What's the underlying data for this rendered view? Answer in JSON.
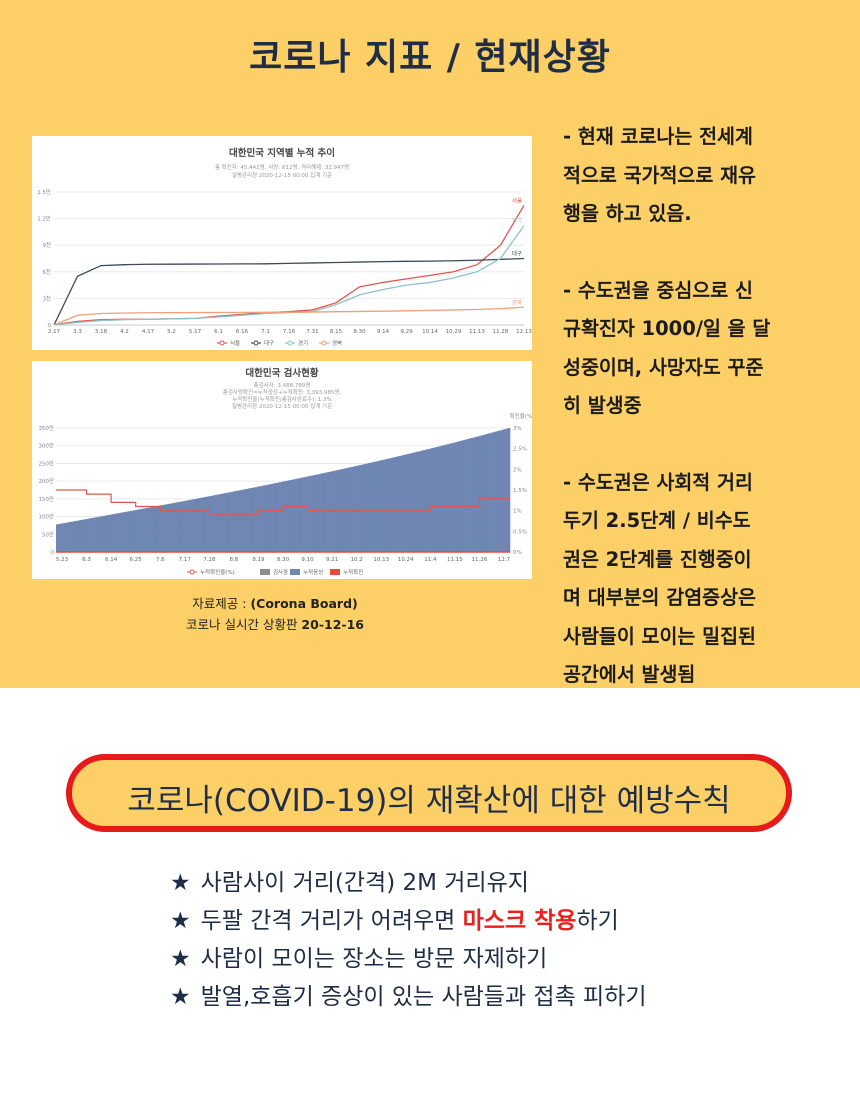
{
  "title": "코로나 지표 / 현재상황",
  "bullets": [
    "- 현재 코로나는 전세계\n적으로 국가적으로 재유\n행을 하고 있음.",
    "- 수도권을 중심으로 신\n규확진자 1000/일 을 달\n성중이며, 사망자도 꾸준\n히 발생중",
    "- 수도권은 사회적 거리\n두기 2.5단계 / 비수도\n권은 2단계를 진행중이\n며 대부분의 감염증상은\n사람들이 모이는 밀집된\n공간에서 발생됨"
  ],
  "source": {
    "line1_prefix": "자료제공 : ",
    "line1_bold": "(Corona Board)",
    "line2_prefix": "코로나 실시간 상황판 ",
    "line2_bold": "20-12-16"
  },
  "banner": "코로나(COVID-19)의 재확산에 대한 예방수칙",
  "rules": [
    {
      "star": "★",
      "before": "사람사이 거리(간격) 2M 거리유지",
      "highlight": "",
      "after": ""
    },
    {
      "star": "★",
      "before": "두팔 간격 거리가 어려우면 ",
      "highlight": "마스크 착용",
      "after": "하기"
    },
    {
      "star": "★",
      "before": "사람이 모이는 장소는 방문 자제하기",
      "highlight": "",
      "after": ""
    },
    {
      "star": "★",
      "before": "발열,호흡기 증상이 있는 사람들과 접촉 피하기",
      "highlight": "",
      "after": ""
    }
  ],
  "colors": {
    "background_top": "#fdd067",
    "title_text": "#1f2d47",
    "banner_border": "#e61a1a",
    "highlight": "#ee1c1c"
  },
  "chart_data": [
    {
      "type": "line",
      "title": "대한민국 지역별 누적 추이",
      "subtitle": [
        "총 확진자: 45,442명, 사망: 612명, 격리해제: 32,947명",
        "질병관리청 2020-12-15 00:00 집계 기준"
      ],
      "x": [
        "2.17",
        "3.3",
        "3.18",
        "4.2",
        "4.17",
        "5.2",
        "5.17",
        "6.1",
        "6.16",
        "7.1",
        "7.16",
        "7.31",
        "8.15",
        "8.30",
        "9.14",
        "9.29",
        "10.14",
        "10.29",
        "11.13",
        "11.28",
        "12.13"
      ],
      "yticks": [
        "0",
        "3천",
        "6천",
        "9천",
        "1.2만",
        "1.5만"
      ],
      "ylim": [
        0,
        15000
      ],
      "series": [
        {
          "name": "서울",
          "color": "#e0564f",
          "values": [
            20,
            400,
            600,
            650,
            650,
            700,
            750,
            1000,
            1200,
            1400,
            1500,
            1700,
            2500,
            4300,
            4800,
            5200,
            5600,
            6000,
            6800,
            9000,
            13500
          ]
        },
        {
          "name": "대구",
          "color": "#3c4a5c",
          "values": [
            0,
            5500,
            6700,
            6800,
            6850,
            6860,
            6870,
            6880,
            6890,
            6900,
            6950,
            7000,
            7050,
            7100,
            7150,
            7180,
            7200,
            7250,
            7300,
            7400,
            7500
          ]
        },
        {
          "name": "경기",
          "color": "#8fc3c9",
          "values": [
            5,
            300,
            500,
            600,
            650,
            700,
            750,
            900,
            1100,
            1300,
            1400,
            1500,
            2300,
            3400,
            4000,
            4500,
            4800,
            5300,
            6000,
            7500,
            11200
          ]
        },
        {
          "name": "경북",
          "color": "#f0a07c",
          "values": [
            0,
            1100,
            1300,
            1350,
            1380,
            1390,
            1400,
            1410,
            1420,
            1430,
            1440,
            1460,
            1500,
            1530,
            1560,
            1600,
            1650,
            1700,
            1750,
            1850,
            2000
          ]
        }
      ],
      "legend": [
        "서울",
        "대구",
        "경기",
        "경북"
      ]
    },
    {
      "type": "bar",
      "title": "대한민국 검사현황",
      "subtitle": [
        "총검사자: 3,488,789명",
        "총검사량확진=누적중상+누적확진: 3,393,985명,",
        "누적확진율(누적확진/총검사완료수): 1.3%",
        "질병관리청 2020-12-15 00:00 집계 기준"
      ],
      "x": [
        "5.23",
        "6.3",
        "6.14",
        "6.25",
        "7.6",
        "7.17",
        "7.28",
        "8.8",
        "8.19",
        "8.30",
        "9.10",
        "9.21",
        "10.2",
        "10.13",
        "10.24",
        "11.4",
        "11.15",
        "11.26",
        "12.7"
      ],
      "yticks": [
        "0",
        "50만",
        "100만",
        "150만",
        "200만",
        "250만",
        "300만",
        "350만"
      ],
      "y2ticks": [
        "0%",
        "0.5%",
        "1%",
        "1.5%",
        "2%",
        "2.5%",
        "3%"
      ],
      "y2label": "확진율(%)",
      "ylim": [
        0,
        3500000
      ],
      "y2lim": [
        0,
        3
      ],
      "bars_start": 780000,
      "bars_end": 3500000,
      "bar_count": 208,
      "rate_series": {
        "name": "누적확진율(%)",
        "color": "#e0564f",
        "values": [
          1.5,
          1.4,
          1.2,
          1.1,
          1.0,
          1.0,
          0.9,
          0.9,
          1.0,
          1.1,
          1.0,
          1.0,
          1.0,
          1.0,
          1.0,
          1.1,
          1.1,
          1.3,
          1.3
        ]
      },
      "legend": [
        "누적확진율(%)",
        "검사중",
        "누적음성",
        "누적확진"
      ],
      "legend_colors": [
        "#e0564f",
        "#8c8c8c",
        "#6f86b3",
        "#e64b3c"
      ]
    }
  ]
}
